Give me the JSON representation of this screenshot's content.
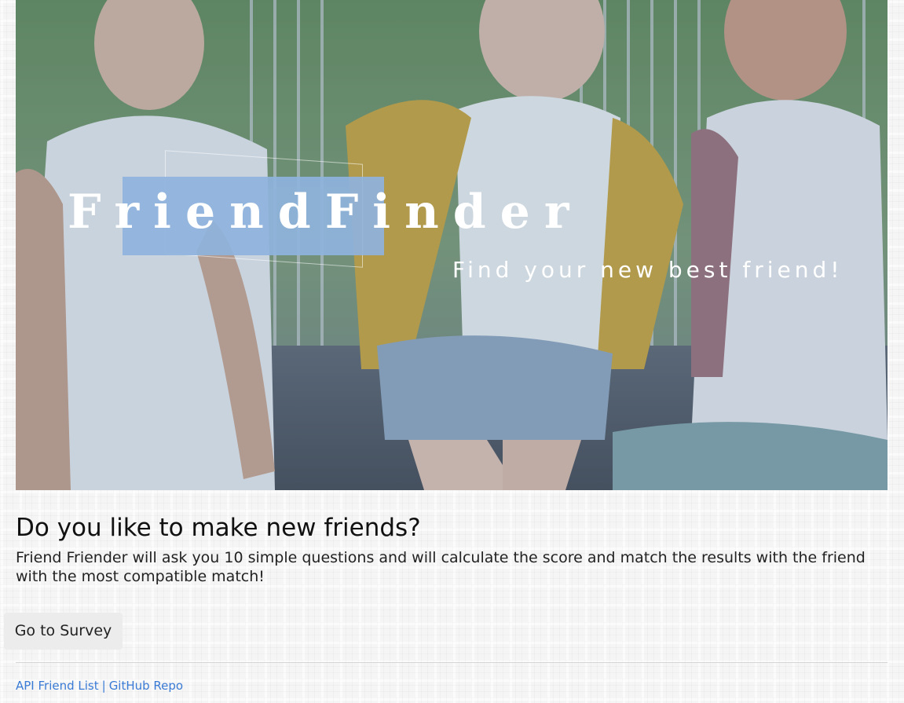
{
  "hero": {
    "brand_title": "FriendFinder",
    "tagline": "Find your new best friend!",
    "image_alt": "three friends smiling on a bench"
  },
  "main": {
    "heading": "Do you like to make new friends?",
    "description": "Friend Friender will ask you 10 simple questions and will calculate the score and match the results with the friend with the most compatible match!",
    "survey_button_label": "Go to Survey"
  },
  "footer": {
    "api_link_label": "API Friend List",
    "separator": "|",
    "github_link_label": "GitHub Repo"
  },
  "colors": {
    "brand_highlight": "#8fb3dd",
    "link": "#3a7bd5",
    "button_bg": "#ececec"
  }
}
